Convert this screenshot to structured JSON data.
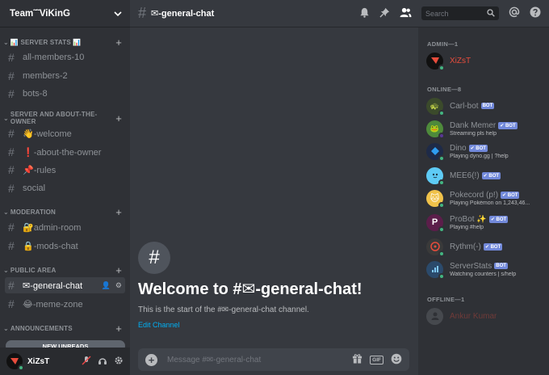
{
  "guild": {
    "name": "Team˜˜ViKinG"
  },
  "sidebar": {
    "categories": [
      {
        "label": "📊 SERVER STATS 📊"
      },
      {
        "label": "SERVER AND ABOUT-THE-OWNER"
      },
      {
        "label": "MODERATION"
      },
      {
        "label": "PUBLIC AREA"
      },
      {
        "label": "ANNOUNCEMENTS"
      }
    ],
    "channels": [
      {
        "label": "all-members-10"
      },
      {
        "label": "members-2"
      },
      {
        "label": "bots-8"
      },
      {
        "label": "👋-welcome"
      },
      {
        "label": "❗-about-the-owner"
      },
      {
        "label": "📌-rules"
      },
      {
        "label": "social"
      },
      {
        "label": "🔐admin-room"
      },
      {
        "label": "🔒-mods-chat"
      },
      {
        "label": "✉-general-chat"
      },
      {
        "label": "😂-meme-zone"
      }
    ],
    "new_unreads": "NEW UNREADS"
  },
  "user": {
    "name": "XiZsT"
  },
  "topbar": {
    "channel": "✉-general-chat",
    "search_placeholder": "Search"
  },
  "welcome": {
    "title": "Welcome to #✉-general-chat!",
    "subtitle": "This is the start of the #✉-general-chat channel.",
    "edit": "Edit Channel"
  },
  "composer": {
    "placeholder": "Message #✉-general-chat",
    "gif": "GIF"
  },
  "members": {
    "admin_header": "ADMIN—1",
    "online_header": "ONLINE—8",
    "offline_header": "OFFLINE—1",
    "bot_label": "BOT",
    "list": [
      {
        "name": "XiZsT",
        "color": "#e74c3c",
        "activity": ""
      },
      {
        "name": "Carl-bot",
        "color": "#8e9297",
        "activity": ""
      },
      {
        "name": "Dank Memer",
        "color": "#8e9297",
        "activity": "Streaming pls help"
      },
      {
        "name": "Dino",
        "color": "#8e9297",
        "activity": "Playing dyno.gg | ?help"
      },
      {
        "name": "MEE6(!)",
        "color": "#8e9297",
        "activity": ""
      },
      {
        "name": "Pokecord (p!)",
        "color": "#8e9297",
        "activity": "Playing Pokémon on 1,243,46..."
      },
      {
        "name": "ProBot ✨",
        "color": "#8e9297",
        "activity": "Playing #help"
      },
      {
        "name": "Rythm(-)",
        "color": "#8e9297",
        "activity": ""
      },
      {
        "name": "ServerStats",
        "color": "#8e9297",
        "activity": "Watching counters | s/help"
      },
      {
        "name": "Ankur Kumar",
        "color": "#8e9297",
        "activity": ""
      }
    ]
  },
  "colors": {
    "online": "#43b581",
    "streaming": "#593695",
    "blurple": "#7289da",
    "link": "#00b0f4"
  }
}
